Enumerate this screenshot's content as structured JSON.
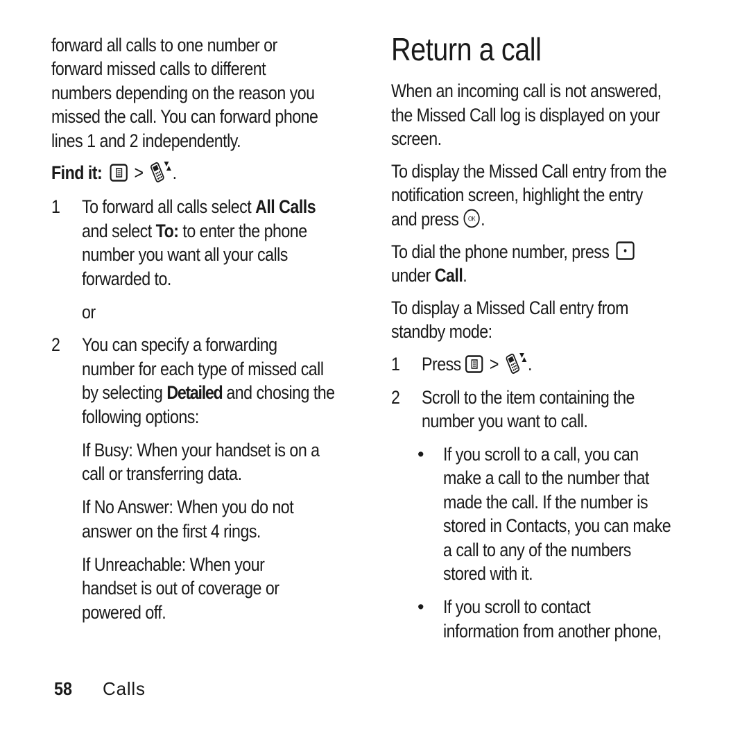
{
  "left": {
    "intro_lines": [
      "forward all calls to one number or",
      "forward missed calls to different",
      "numbers depending on the reason you",
      "missed the call. You can forward phone",
      "lines 1 and 2 independently."
    ],
    "find_it": {
      "label": "Find it:",
      "separator": ">",
      "end": ".",
      "icons": [
        "menu-key-icon",
        "phone-calls-icon"
      ]
    },
    "step1": {
      "number": "1",
      "line1_pre": "To forward all calls select ",
      "line1_bold": "All Calls",
      "line2_pre": "and select ",
      "line2_bold": "To:",
      "line2_post": " to enter the phone",
      "line3": "number you want all your calls",
      "line4": "forwarded to."
    },
    "or_text": "or",
    "step2": {
      "number": "2",
      "line1": "You can specify a forwarding",
      "line2": "number for each type of missed call",
      "line3_pre": "by selecting ",
      "line3_bold": "Detailed",
      "line3_post": " and chosing the",
      "line4": "following options:"
    },
    "options": [
      {
        "lines": [
          "If Busy: When your handset is on a",
          "call or transferring data."
        ]
      },
      {
        "lines": [
          "If No Answer: When you do not",
          "answer on the first 4 rings."
        ]
      },
      {
        "lines": [
          "If Unreachable: When your",
          "handset is out of coverage or",
          "powered off."
        ]
      }
    ]
  },
  "right": {
    "title": "Return a call",
    "para1": [
      "When an incoming call is not answered,",
      "the Missed Call log is displayed on your",
      "screen."
    ],
    "para2": {
      "line1": "To display the Missed Call entry from the",
      "line2": "notification screen, highlight the entry",
      "line3_pre": "and press ",
      "line3_post": ".",
      "icon": "ok-key-icon"
    },
    "para3": {
      "line1": "To dial the phone number, press ",
      "line2_pre": "under ",
      "line2_bold": "Call",
      "line2_post": ".",
      "icon": "center-softkey-icon"
    },
    "para4": [
      "To display a Missed Call entry from",
      "standby mode:"
    ],
    "step1": {
      "number": "1",
      "pre": "Press ",
      "separator": ">",
      "end": "."
    },
    "step2": {
      "number": "2",
      "lines": [
        "Scroll to the item containing the",
        "number you want to call."
      ]
    },
    "bullets": [
      {
        "symbol": "•",
        "lines": [
          "If you scroll to a call, you can",
          "make a call to the number that",
          "made the call. If the number is",
          "stored in Contacts, you can make",
          "a call to any of the numbers",
          "stored with it."
        ]
      },
      {
        "symbol": "•",
        "lines": [
          "If you scroll to contact",
          "information from another phone,"
        ]
      }
    ]
  },
  "footer": {
    "page_number": "58",
    "section": "Calls"
  }
}
